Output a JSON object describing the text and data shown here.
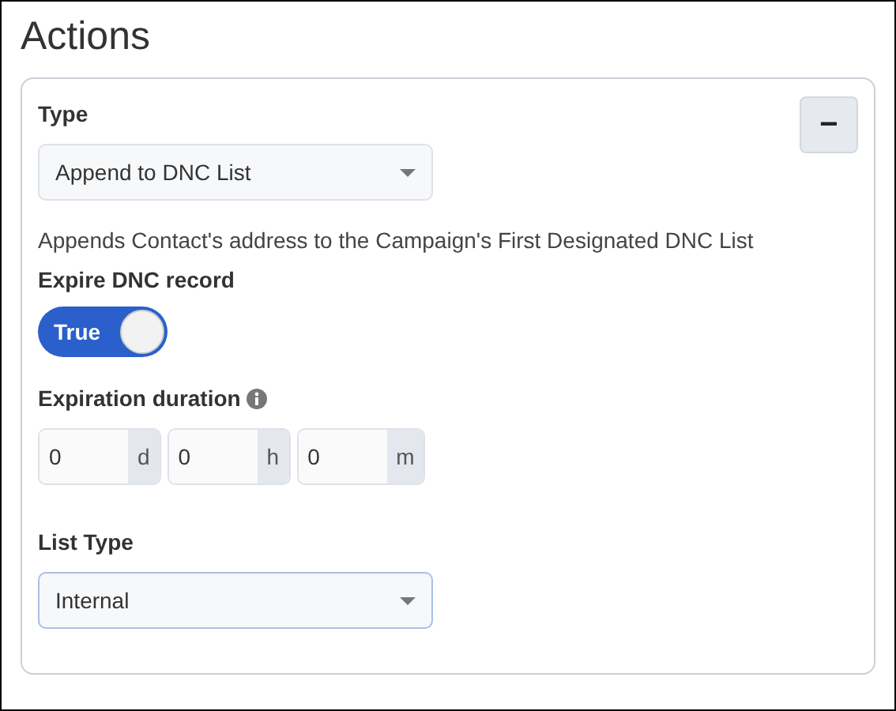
{
  "title": "Actions",
  "action": {
    "type_field": {
      "label": "Type",
      "value": "Append to DNC List"
    },
    "description": "Appends Contact's address to the Campaign's First Designated DNC List",
    "expire_toggle": {
      "label": "Expire DNC record",
      "on": true,
      "text": "True"
    },
    "duration": {
      "label": "Expiration duration",
      "parts": [
        {
          "value": "0",
          "unit": "d"
        },
        {
          "value": "0",
          "unit": "h"
        },
        {
          "value": "0",
          "unit": "m"
        }
      ]
    },
    "list_type_field": {
      "label": "List Type",
      "value": "Internal",
      "focused": true
    },
    "remove_button": {
      "text": "−"
    }
  }
}
